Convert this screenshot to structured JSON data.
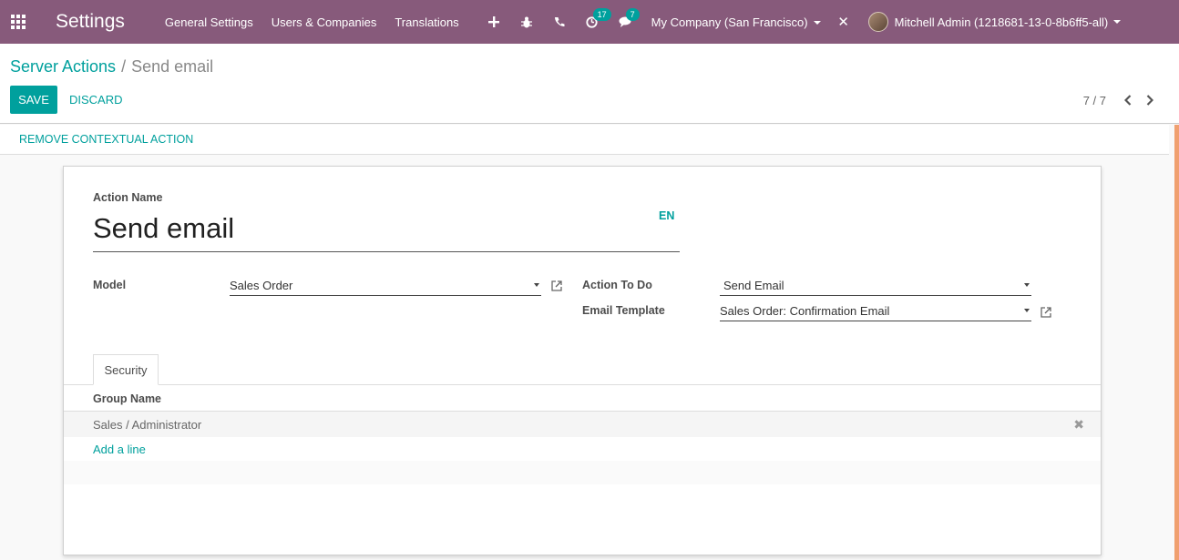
{
  "navbar": {
    "brand": "Settings",
    "menu": [
      "General Settings",
      "Users & Companies",
      "Translations"
    ],
    "activity_badge": "17",
    "messages_badge": "7",
    "company": "My Company (San Francisco)",
    "user": "Mitchell Admin (1218681-13-0-8b6ff5-all)",
    "icons": [
      "apps-icon",
      "plus-icon",
      "bug-icon",
      "phone-icon",
      "clock-icon",
      "chat-icon",
      "tools-icon"
    ]
  },
  "breadcrumb": {
    "parent": "Server Actions",
    "separator": "/",
    "current": "Send email"
  },
  "buttons": {
    "save": "SAVE",
    "discard": "DISCARD",
    "remove_contextual": "REMOVE CONTEXTUAL ACTION"
  },
  "pager": {
    "value": "7 / 7",
    "prev": "‹",
    "next": "›"
  },
  "form": {
    "action_name_label": "Action Name",
    "action_name": "Send email",
    "lang": "EN",
    "model_label": "Model",
    "model_value": "Sales Order",
    "action_to_do_label": "Action To Do",
    "action_to_do_value": "Send Email",
    "email_template_label": "Email Template",
    "email_template_value": "Sales Order: Confirmation Email"
  },
  "tabs": [
    {
      "label": "Security"
    }
  ],
  "security_table": {
    "header": "Group Name",
    "rows": [
      "Sales / Administrator"
    ],
    "add_line": "Add a line",
    "delete_glyph": "✖"
  },
  "colors": {
    "navbar": "#875a7b",
    "accent": "#00a09d"
  }
}
